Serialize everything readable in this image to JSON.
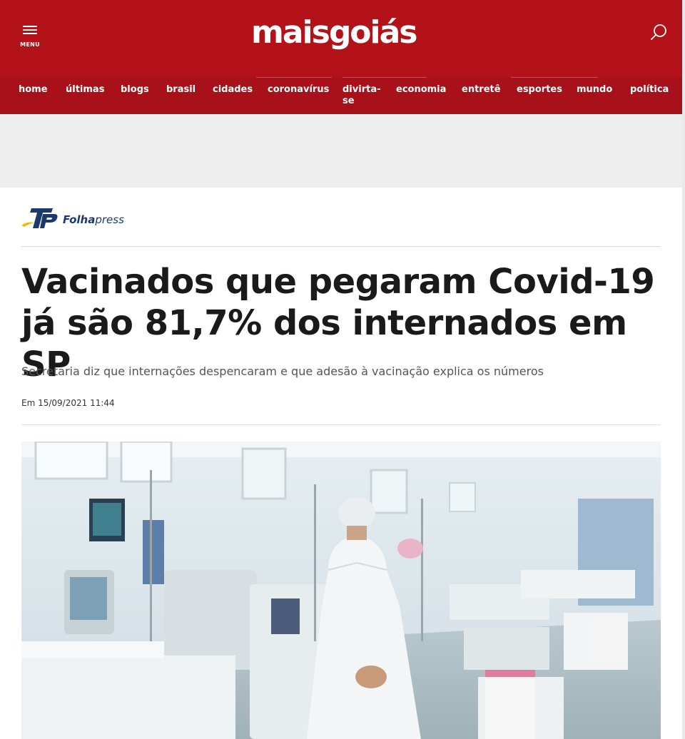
{
  "header": {
    "menu_label": "MENU",
    "logo_part1": "mais",
    "logo_part2": "goiás",
    "bg_color": "#b31218"
  },
  "nav": {
    "items": [
      "home",
      "últimas",
      "blogs",
      "brasil",
      "cidades",
      "coronavírus",
      "divirta-",
      "economia",
      "entretê",
      "esportes",
      "mundo",
      "política"
    ],
    "item_wrap": "se"
  },
  "article": {
    "source_bold": "Folha",
    "source_light": "press",
    "headline": "Vacinados que pegaram Covid-19 já são 81,7% dos internados em SP",
    "subtitle": "Secretaria diz que internações despencaram e que adesão à vacinação explica os números",
    "date": "Em 15/09/2021 11:44"
  },
  "icons": {
    "menu": "hamburger-icon",
    "search": "search-icon",
    "source_logo": "folhapress-logo"
  }
}
